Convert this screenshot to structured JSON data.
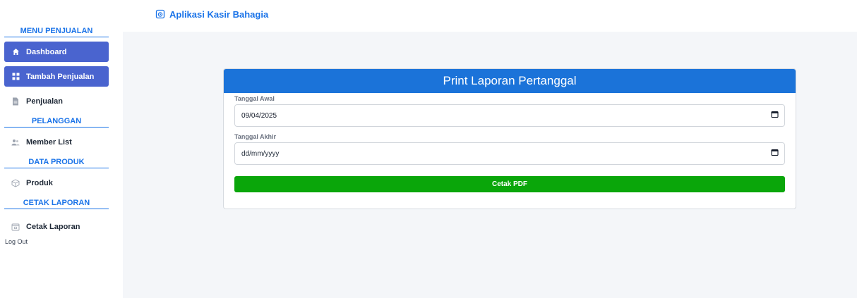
{
  "app": {
    "title": "Aplikasi Kasir Bahagia"
  },
  "sidebar": {
    "sections": [
      {
        "title": "MENU PENJUALAN"
      },
      {
        "title": "PELANGGAN"
      },
      {
        "title": "DATA PRODUK"
      },
      {
        "title": "CETAK LAPORAN"
      }
    ],
    "items": {
      "dashboard": "Dashboard",
      "tambah_penjualan": "Tambah Penjualan",
      "penjualan": "Penjualan",
      "member_list": "Member List",
      "produk": "Produk",
      "cetak_laporan": "Cetak Laporan"
    },
    "logout": "Log Out"
  },
  "form": {
    "title": "Print Laporan Pertanggal",
    "tanggal_awal_label": "Tanggal Awal",
    "tanggal_awal_value": "09/04/2025",
    "tanggal_akhir_label": "Tanggal Akhir",
    "tanggal_akhir_value": "dd/mm/yyyy",
    "submit_label": "Cetak PDF"
  },
  "colors": {
    "accent": "#1a73e8",
    "active_nav": "#4a64cf",
    "card_header": "#1b73d9",
    "button": "#0aa60a"
  }
}
